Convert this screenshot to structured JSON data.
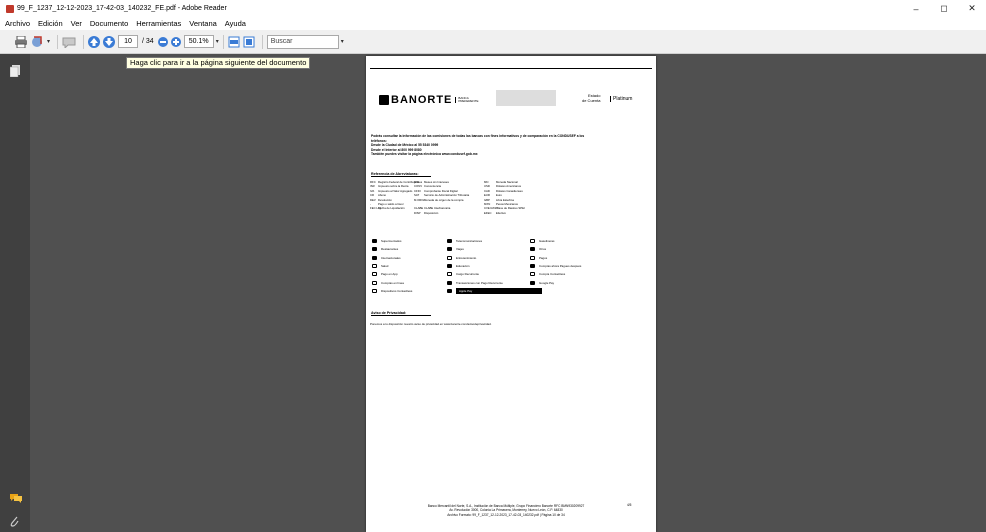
{
  "window": {
    "title": "99_F_1237_12-12-2023_17-42-03_140232_FE.pdf - Adobe Reader",
    "minimize": "–",
    "maximize": "◻",
    "close": "✕"
  },
  "menu": [
    "Archivo",
    "Edición",
    "Ver",
    "Documento",
    "Herramientas",
    "Ventana",
    "Ayuda"
  ],
  "toolbar": {
    "current_page": "10",
    "total_pages": "/ 34",
    "zoom": "50.1%",
    "search_placeholder": "Buscar"
  },
  "tooltip": "Haga clic para ir a la página siguiente del documento",
  "document": {
    "brand": "BANORTE",
    "banca_label": "BANCA PREFERENTE",
    "estado_line1": "Estado",
    "estado_line2": "de Cuenta",
    "platinum": "Platinum",
    "intro": [
      "Podrás consultar la información de las comisiones de todas las bancas con fines informativos y de comparación en la CONDUSEF a los",
      "teléfonos:",
      "Desde la Ciudad de México al 55 5340 0999",
      "Desde el Interior al 800 999 8080",
      "También puedes visitar la página electrónica www.condusef.gob.mx"
    ],
    "abbr_title": "Referencia de Abreviaturas:",
    "abbr_rows": [
      [
        "RFC",
        "Registro Federal de Contribuyentes",
        "MSI",
        "Meses sin Intereses",
        "MN",
        "Moneda Nacional"
      ],
      [
        "ISR",
        "Impuesto sobre la Renta",
        "CONV",
        "Conveniencia",
        "USD",
        "Dólares Americanos"
      ],
      [
        "IVA",
        "Impuesto al Valor Agregado",
        "CFDI",
        "Comprobante Fiscal Digital",
        "CAD",
        "Dólares Canadienses"
      ],
      [
        "CR",
        "Abono",
        "SAT",
        "Servicio de Administración Tributaria",
        "EUR",
        "Euro"
      ],
      [
        "DEV",
        "Devolución",
        "M.ORIG",
        "Moneda de origen de la compra",
        "GBP",
        "Libra Esterlina"
      ],
      [
        "-",
        "Pago o saldo a favor",
        "",
        "",
        "MXN",
        "Pesos Mexicanos"
      ],
      [
        "FEC LIQ",
        "Fecha de Liquidación",
        "CLABE",
        "CLABE Interbancaria",
        "CVE RAST",
        "Clave de Rastreo SPEI"
      ],
      [
        "",
        "",
        "DISP",
        "Disposición",
        "EFEC",
        "Efectivo"
      ]
    ],
    "icon_rows": [
      [
        "Supermercados",
        "Telecomunicaciones",
        "Gasolineras"
      ],
      [
        "Restaurantes",
        "Viajes",
        "Otros"
      ],
      [
        "Internacionales",
        "Entretenimiento",
        "Pagos"
      ],
      [
        "Salud",
        "Educación",
        "Compras ahora Pagues después"
      ],
      [
        "Pago en App",
        "Cargo Recurrente",
        "Compra Contactless"
      ],
      [
        "Compras en línea",
        "Transacciones con Pago Recurrente",
        "Google Pay"
      ],
      [
        "Dispositivos Contactless",
        "Apple Pay",
        ""
      ]
    ],
    "privacy_title": "Aviso de Privacidad:",
    "privacy_text": "Ponemos a tu disposición nuestro aviso de privacidad en www.banorte.com/avisodeprivacidad.",
    "footer_line1": "Banco Mercantil del Norte, S.A., Institución de Banca Múltiple, Grupo Financiero Banorte RFC BMN930209927",
    "footer_line2": "Av. Revolución 3000, Colonia La Primavera, Monterrey, Nuevo León, C.P. 64830",
    "footer_line3": "Archivo Formato: 99_F_1237_12-12-2023_17-42-03_140232.pdf | Página 10 de 34",
    "page_label": "4/5"
  }
}
